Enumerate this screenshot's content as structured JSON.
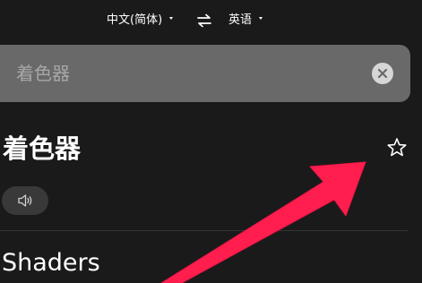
{
  "language_bar": {
    "source_language": "中文(简体)",
    "target_language": "英语",
    "swap_icon": "swap-arrows-icon"
  },
  "search": {
    "value": "",
    "placeholder": "着色器",
    "clear_icon": "clear-circle-x-icon"
  },
  "result": {
    "headword": "着色器",
    "favorite_icon": "star-outline-icon",
    "audio_icon": "speaker-icon",
    "translation": "Shaders"
  },
  "annotation": {
    "arrow_color": "#ff1e4e",
    "arrow_icon": "red-pointer-arrow"
  },
  "colors": {
    "background": "#1b1a1b",
    "search_box": "#69696a",
    "placeholder": "#a7a7a7",
    "audio_pill": "#3a393a"
  }
}
